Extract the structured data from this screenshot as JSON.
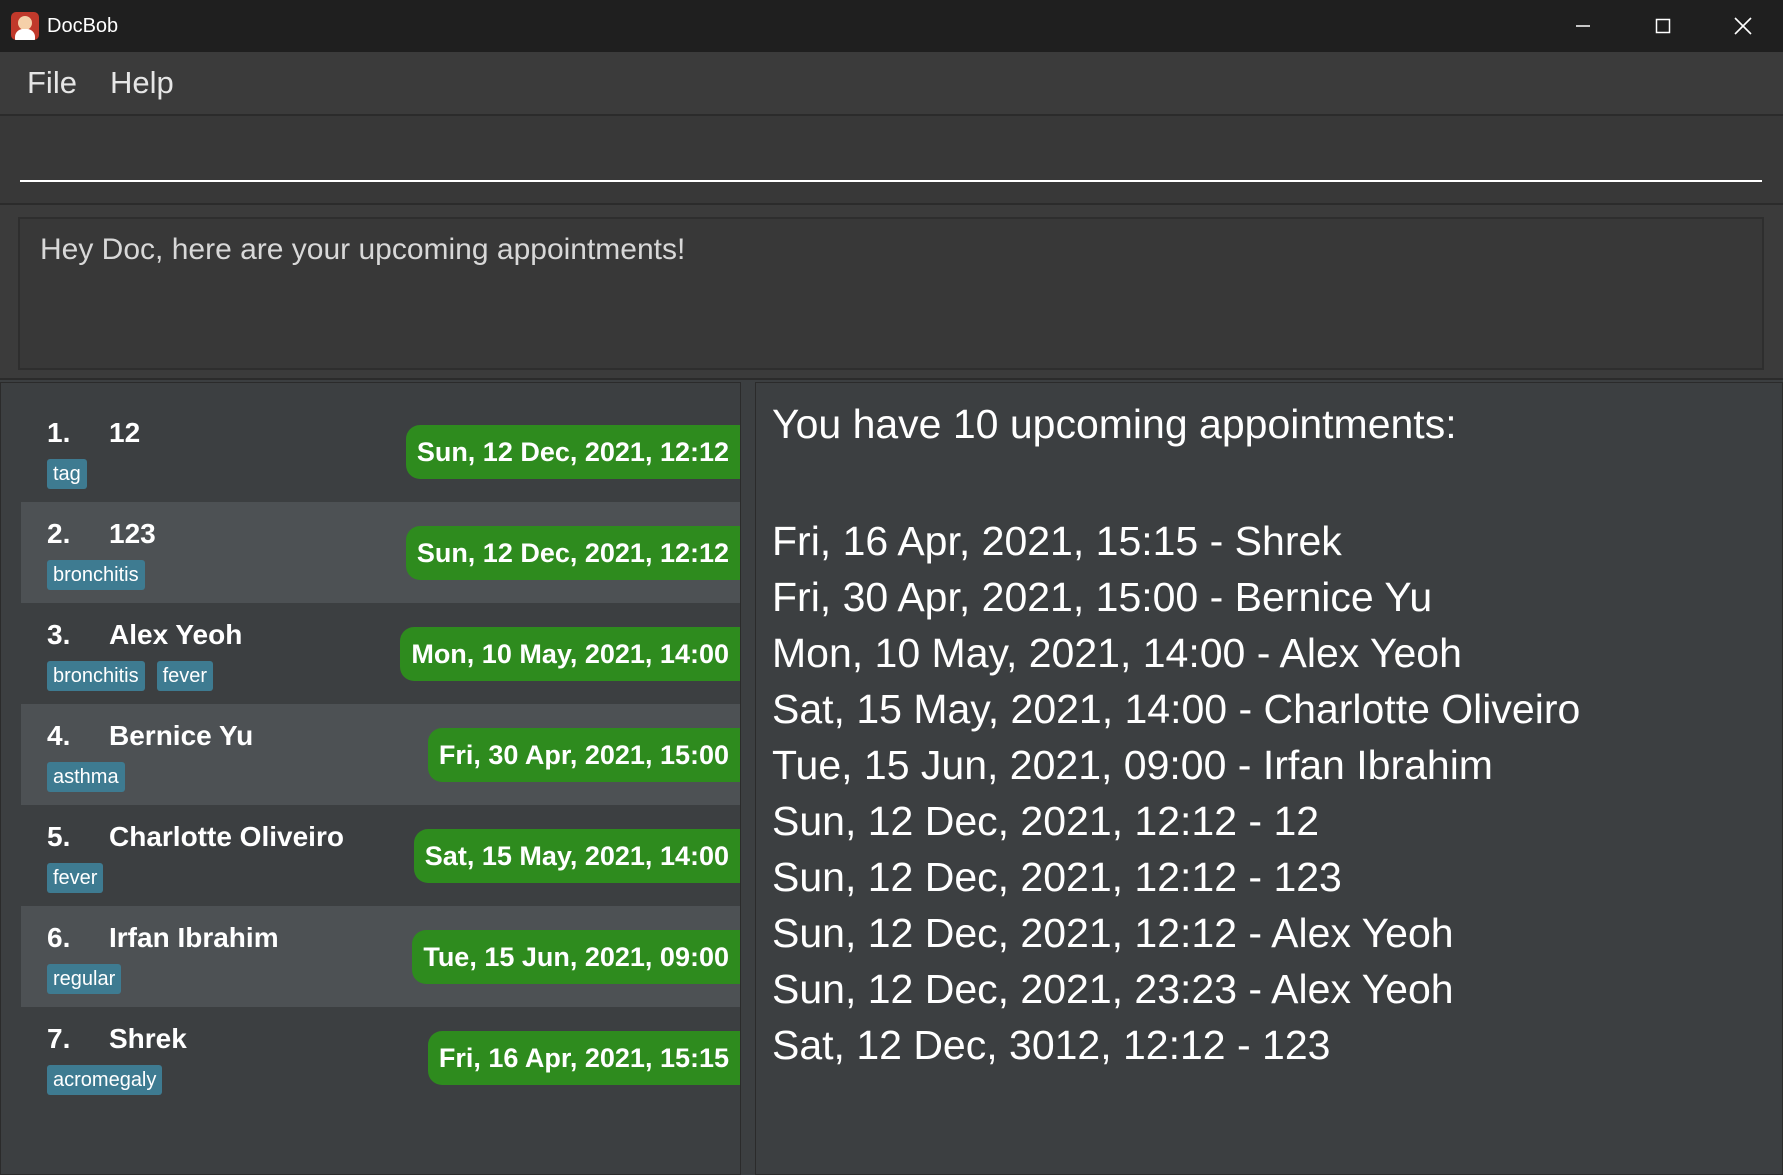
{
  "window": {
    "title": "DocBob",
    "icon": "doctor-app-icon"
  },
  "menu": {
    "items": [
      "File",
      "Help"
    ]
  },
  "command": {
    "value": "",
    "placeholder": ""
  },
  "result": {
    "message": "Hey Doc, here are your upcoming appointments!"
  },
  "patients": [
    {
      "index": "1.",
      "name": "12",
      "tags": [
        "tag"
      ],
      "appointment": "Sun, 12 Dec, 2021, 12:12"
    },
    {
      "index": "2.",
      "name": "123",
      "tags": [
        "bronchitis"
      ],
      "appointment": "Sun, 12 Dec, 2021, 12:12"
    },
    {
      "index": "3.",
      "name": "Alex Yeoh",
      "tags": [
        "bronchitis",
        "fever"
      ],
      "appointment": "Mon, 10 May, 2021, 14:00"
    },
    {
      "index": "4.",
      "name": "Bernice Yu",
      "tags": [
        "asthma"
      ],
      "appointment": "Fri, 30 Apr, 2021, 15:00"
    },
    {
      "index": "5.",
      "name": "Charlotte Oliveiro",
      "tags": [
        "fever"
      ],
      "appointment": "Sat, 15 May, 2021, 14:00"
    },
    {
      "index": "6.",
      "name": "Irfan Ibrahim",
      "tags": [
        "regular"
      ],
      "appointment": "Tue, 15 Jun, 2021, 09:00"
    },
    {
      "index": "7.",
      "name": "Shrek",
      "tags": [
        "acromegaly"
      ],
      "appointment": "Fri, 16 Apr, 2021, 15:15"
    }
  ],
  "appointments": {
    "heading": "You have 10 upcoming appointments:",
    "items": [
      "Fri, 16 Apr, 2021, 15:15 - Shrek",
      "Fri, 30 Apr, 2021, 15:00 - Bernice Yu",
      "Mon, 10 May, 2021, 14:00 - Alex Yeoh",
      "Sat, 15 May, 2021, 14:00 - Charlotte Oliveiro",
      "Tue, 15 Jun, 2021, 09:00 - Irfan Ibrahim",
      "Sun, 12 Dec, 2021, 12:12 - 12",
      "Sun, 12 Dec, 2021, 12:12 - 123",
      "Sun, 12 Dec, 2021, 12:12 - Alex Yeoh",
      "Sun, 12 Dec, 2021, 23:23 - Alex Yeoh",
      "Sat, 12 Dec, 3012, 12:12 - 123"
    ]
  },
  "colors": {
    "appointment_pill": "#2e8b1e",
    "tag": "#3e7b91",
    "background": "#3c3f41",
    "titlebar": "#1f1f1f"
  }
}
